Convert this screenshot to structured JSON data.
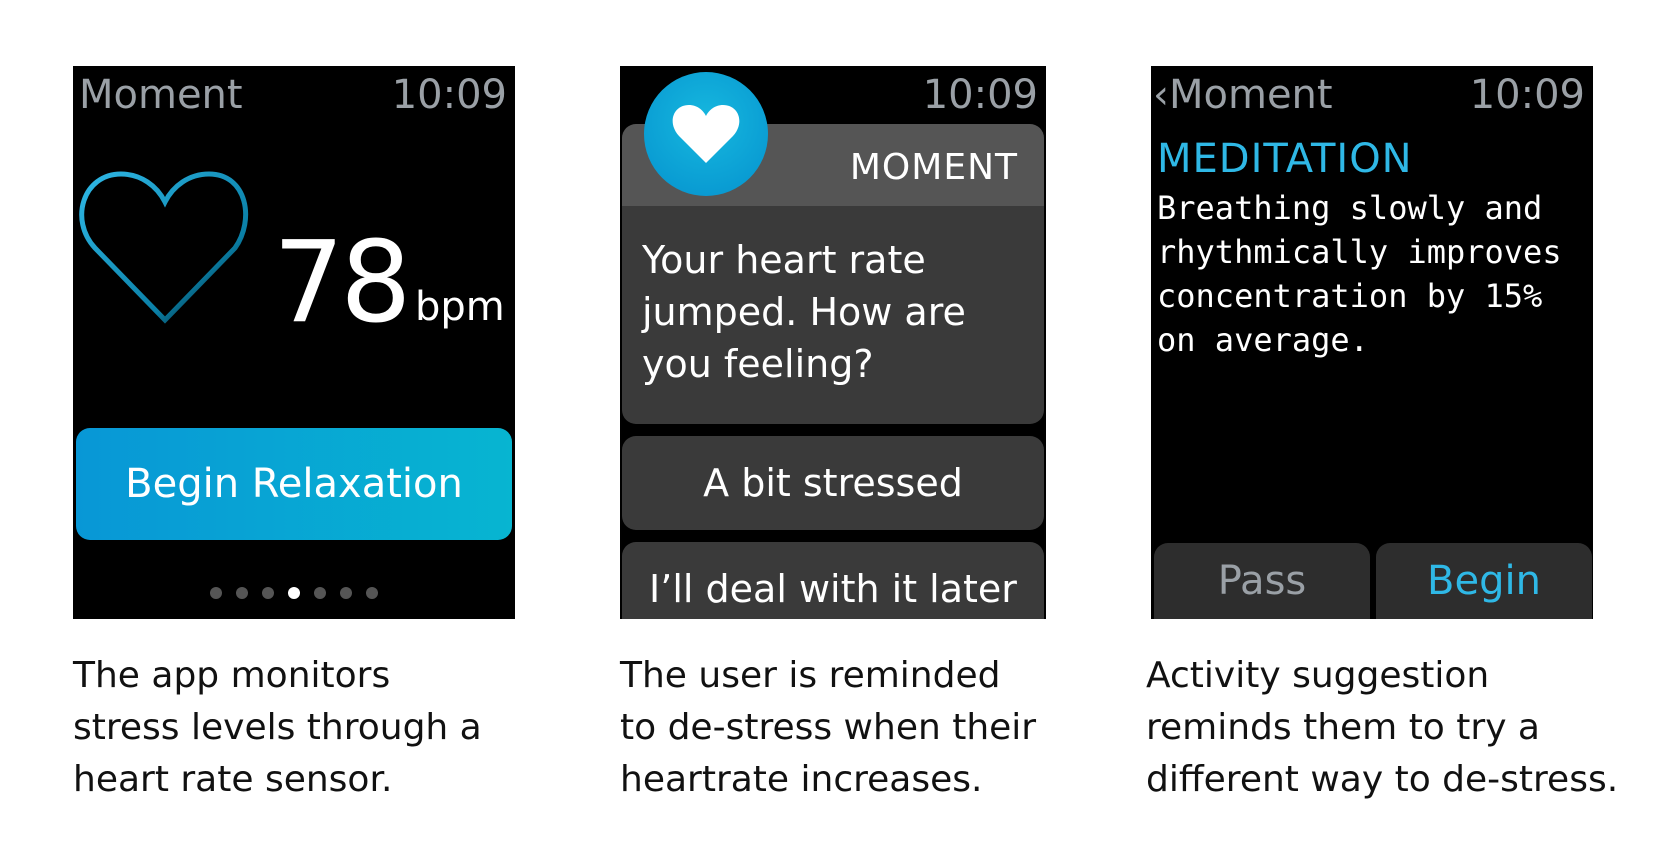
{
  "screens": [
    {
      "app_name": "Moment",
      "time": "10:09",
      "heart_rate": "78",
      "unit": "bpm",
      "button_label": "Begin Relaxation",
      "page_dots": {
        "count": 7,
        "active_index": 3
      },
      "caption": "The app monitors\nstress levels through a\nheart rate sensor."
    },
    {
      "time": "10:09",
      "notification_app": "MOMENT",
      "message": "Your heart rate jumped. How are you feeling?",
      "replies": [
        "A bit stressed",
        "I’ll deal with it later"
      ],
      "caption": "The user is reminded\nto de-stress when their\nheartrate increases."
    },
    {
      "back_label": "Moment",
      "time": "10:09",
      "heading": "MEDITATION",
      "body": "Breathing slowly and rhythmically improves concentration by 15% on average.",
      "actions": [
        "Pass",
        "Begin"
      ],
      "caption": "Activity suggestion\nreminds them to try a\ndifferent way to de-stress."
    }
  ],
  "colors": {
    "accent": "#0aa3d8",
    "heading": "#2fb8e6",
    "muted": "#9aa0a6",
    "card": "#3a3a3a"
  }
}
